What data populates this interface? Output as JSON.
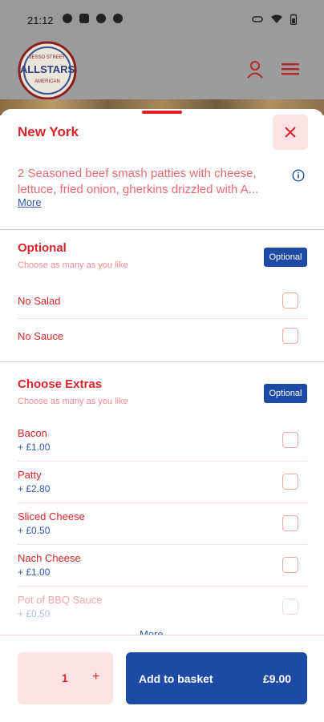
{
  "status_bar": {
    "time": "21:12"
  },
  "header": {
    "logo_top_text": "JESSO STREET",
    "logo_main_text": "ALLSTARS",
    "logo_bottom_text": "AMERICAN"
  },
  "item": {
    "title": "New York",
    "description": "2 Seasoned beef smash patties with cheese, lettuce, fried onion, gherkins drizzled with A...",
    "more_label": "More"
  },
  "sections": [
    {
      "title": "Optional",
      "subtitle": "Choose as many as you like",
      "badge": "Optional",
      "options": [
        {
          "label": "No Salad",
          "price": ""
        },
        {
          "label": "No Sauce",
          "price": ""
        }
      ]
    },
    {
      "title": "Choose Extras",
      "subtitle": "Choose as many as you like",
      "badge": "Optional",
      "options": [
        {
          "label": "Bacon",
          "price": "+ £1.00"
        },
        {
          "label": "Patty",
          "price": "+ £2.80"
        },
        {
          "label": "Sliced Cheese",
          "price": "+ £0.50"
        },
        {
          "label": "Nach Cheese",
          "price": "+ £1.00"
        },
        {
          "label": "Pot of BBQ Sauce",
          "price": "+ £0.50"
        }
      ],
      "more_label": "More"
    }
  ],
  "footer": {
    "quantity": "1",
    "plus": "+",
    "add_label": "Add to basket",
    "price": "£9.00"
  },
  "colors": {
    "primary_red": "#d9252b",
    "primary_blue": "#1e4aa5",
    "light_pink": "#fde3e3"
  }
}
